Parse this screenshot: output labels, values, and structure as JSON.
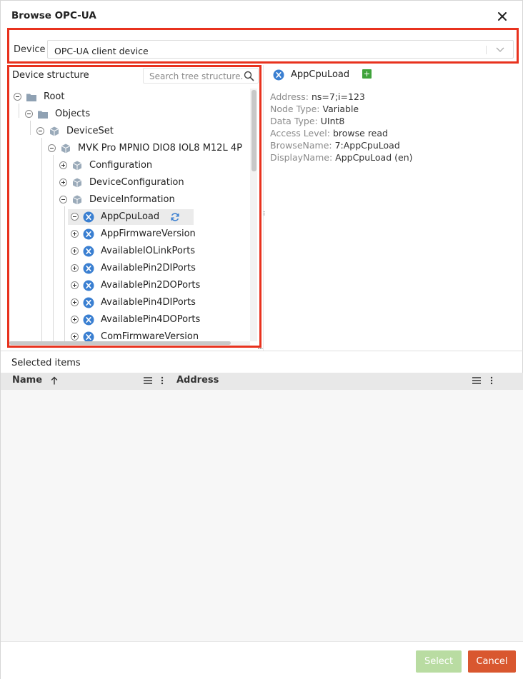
{
  "dialog": {
    "title": "Browse OPC-UA"
  },
  "device": {
    "label": "Device",
    "selected": "OPC-UA client device"
  },
  "tree": {
    "heading": "Device structure",
    "search_placeholder": "Search tree structure...",
    "nodes": [
      {
        "label": "Root",
        "icon": "folder-icon",
        "toggle": "collapse"
      },
      {
        "label": "Objects",
        "icon": "folder-icon",
        "toggle": "collapse"
      },
      {
        "label": "DeviceSet",
        "icon": "cube-icon",
        "toggle": "collapse"
      },
      {
        "label": "MVK Pro MPNIO DIO8 IOL8 M12L 4P",
        "icon": "cube-icon",
        "toggle": "collapse"
      },
      {
        "label": "Configuration",
        "icon": "cube-icon",
        "toggle": "expand"
      },
      {
        "label": "DeviceConfiguration",
        "icon": "cube-icon",
        "toggle": "expand"
      },
      {
        "label": "DeviceInformation",
        "icon": "cube-icon",
        "toggle": "collapse"
      },
      {
        "label": "AppCpuLoad",
        "icon": "variable-icon",
        "toggle": "collapse",
        "selected": true
      },
      {
        "label": "AppFirmwareVersion",
        "icon": "variable-icon",
        "toggle": "expand"
      },
      {
        "label": "AvailableIOLinkPorts",
        "icon": "variable-icon",
        "toggle": "expand"
      },
      {
        "label": "AvailablePin2DIPorts",
        "icon": "variable-icon",
        "toggle": "expand"
      },
      {
        "label": "AvailablePin2DOPorts",
        "icon": "variable-icon",
        "toggle": "expand"
      },
      {
        "label": "AvailablePin4DIPorts",
        "icon": "variable-icon",
        "toggle": "expand"
      },
      {
        "label": "AvailablePin4DOPorts",
        "icon": "variable-icon",
        "toggle": "expand"
      },
      {
        "label": "ComFirmwareVersion",
        "icon": "variable-icon",
        "toggle": "expand"
      }
    ]
  },
  "details": {
    "name": "AppCpuLoad",
    "properties": [
      {
        "key": "Address:",
        "value": "ns=7;i=123"
      },
      {
        "key": "Node Type:",
        "value": "Variable"
      },
      {
        "key": "Data Type:",
        "value": "UInt8"
      },
      {
        "key": "Access Level:",
        "value": "browse read"
      },
      {
        "key": "BrowseName:",
        "value": "7:AppCpuLoad"
      },
      {
        "key": "DisplayName:",
        "value": "AppCpuLoad (en)"
      }
    ]
  },
  "selected_items": {
    "title": "Selected items",
    "columns": {
      "name": "Name",
      "address": "Address"
    }
  },
  "footer": {
    "select_label": "Select",
    "cancel_label": "Cancel"
  },
  "colors": {
    "highlight_border": "#e8321e",
    "accent_green": "#3fa33b",
    "cancel": "#d9572f",
    "select_disabled": "#b9dca2",
    "variable_icon": "#3a7fd1"
  }
}
